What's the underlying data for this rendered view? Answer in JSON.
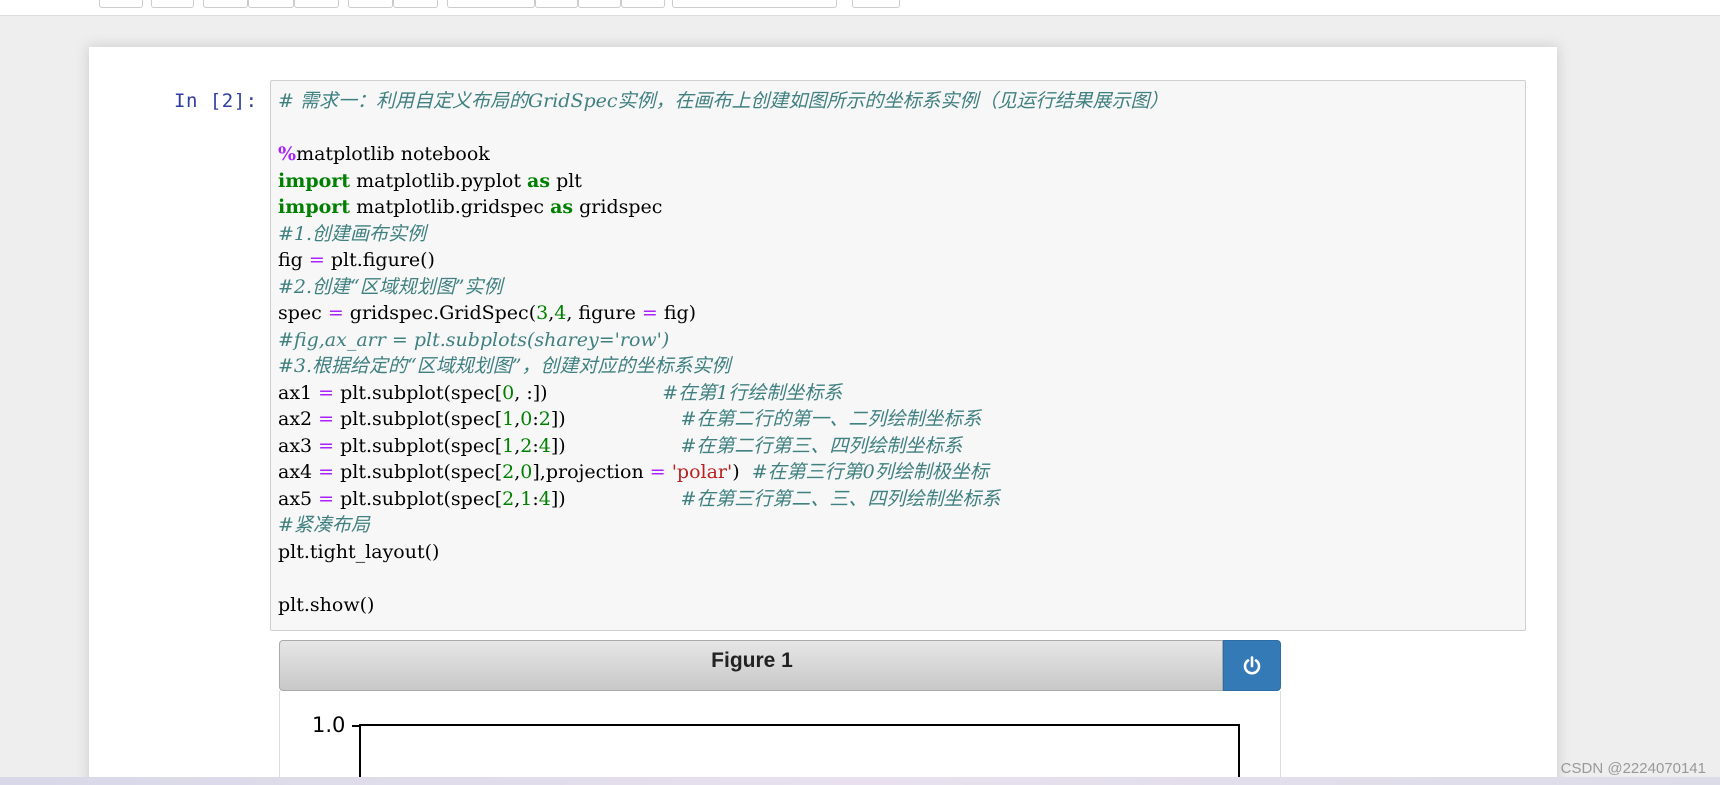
{
  "cell": {
    "prompt": "In  [2]:",
    "lines": [
      [
        {
          "t": "# 需求一：利用自定义布局的GridSpec实例，在画布上创建如图所示的坐标系实例（见运行结果展示图）",
          "c": "com"
        }
      ],
      [],
      [
        {
          "t": "%",
          "c": "magic"
        },
        {
          "t": "matplotlib notebook",
          "c": ""
        }
      ],
      [
        {
          "t": "import",
          "c": "kw"
        },
        {
          "t": " matplotlib.pyplot ",
          "c": ""
        },
        {
          "t": "as",
          "c": "kw"
        },
        {
          "t": " plt",
          "c": ""
        }
      ],
      [
        {
          "t": "import",
          "c": "kw"
        },
        {
          "t": " matplotlib.gridspec ",
          "c": ""
        },
        {
          "t": "as",
          "c": "kw"
        },
        {
          "t": " gridspec",
          "c": ""
        }
      ],
      [
        {
          "t": "#1.创建画布实例",
          "c": "com"
        }
      ],
      [
        {
          "t": "fig ",
          "c": ""
        },
        {
          "t": "=",
          "c": "op"
        },
        {
          "t": " plt.figure()",
          "c": ""
        }
      ],
      [
        {
          "t": "#2.创建“区域规划图”实例",
          "c": "com"
        }
      ],
      [
        {
          "t": "spec ",
          "c": ""
        },
        {
          "t": "=",
          "c": "op"
        },
        {
          "t": " gridspec.GridSpec(",
          "c": ""
        },
        {
          "t": "3",
          "c": "num"
        },
        {
          "t": ",",
          "c": ""
        },
        {
          "t": "4",
          "c": "num"
        },
        {
          "t": ", figure ",
          "c": ""
        },
        {
          "t": "=",
          "c": "op"
        },
        {
          "t": " fig)",
          "c": ""
        }
      ],
      [
        {
          "t": "#fig,ax_arr = plt.subplots(sharey='row')",
          "c": "com"
        }
      ],
      [
        {
          "t": "#3.根据给定的“区域规划图”，创建对应的坐标系实例",
          "c": "com"
        }
      ],
      [
        {
          "t": "ax1 ",
          "c": ""
        },
        {
          "t": "=",
          "c": "op"
        },
        {
          "t": " plt.subplot(spec[",
          "c": ""
        },
        {
          "t": "0",
          "c": "num"
        },
        {
          "t": ", :])                   ",
          "c": ""
        },
        {
          "t": "#在第1行绘制坐标系",
          "c": "com"
        }
      ],
      [
        {
          "t": "ax2 ",
          "c": ""
        },
        {
          "t": "=",
          "c": "op"
        },
        {
          "t": " plt.subplot(spec[",
          "c": ""
        },
        {
          "t": "1",
          "c": "num"
        },
        {
          "t": ",",
          "c": ""
        },
        {
          "t": "0",
          "c": "num"
        },
        {
          "t": ":",
          "c": ""
        },
        {
          "t": "2",
          "c": "num"
        },
        {
          "t": "])                   ",
          "c": ""
        },
        {
          "t": "#在第二行的第一、二列绘制坐标系",
          "c": "com"
        }
      ],
      [
        {
          "t": "ax3 ",
          "c": ""
        },
        {
          "t": "=",
          "c": "op"
        },
        {
          "t": " plt.subplot(spec[",
          "c": ""
        },
        {
          "t": "1",
          "c": "num"
        },
        {
          "t": ",",
          "c": ""
        },
        {
          "t": "2",
          "c": "num"
        },
        {
          "t": ":",
          "c": ""
        },
        {
          "t": "4",
          "c": "num"
        },
        {
          "t": "])                   ",
          "c": ""
        },
        {
          "t": "#在第二行第三、四列绘制坐标系",
          "c": "com"
        }
      ],
      [
        {
          "t": "ax4 ",
          "c": ""
        },
        {
          "t": "=",
          "c": "op"
        },
        {
          "t": " plt.subplot(spec[",
          "c": ""
        },
        {
          "t": "2",
          "c": "num"
        },
        {
          "t": ",",
          "c": ""
        },
        {
          "t": "0",
          "c": "num"
        },
        {
          "t": "],projection ",
          "c": ""
        },
        {
          "t": "=",
          "c": "op"
        },
        {
          "t": " ",
          "c": ""
        },
        {
          "t": "'polar'",
          "c": "str"
        },
        {
          "t": ")  ",
          "c": ""
        },
        {
          "t": "#在第三行第0列绘制极坐标",
          "c": "com"
        }
      ],
      [
        {
          "t": "ax5 ",
          "c": ""
        },
        {
          "t": "=",
          "c": "op"
        },
        {
          "t": " plt.subplot(spec[",
          "c": ""
        },
        {
          "t": "2",
          "c": "num"
        },
        {
          "t": ",",
          "c": ""
        },
        {
          "t": "1",
          "c": "num"
        },
        {
          "t": ":",
          "c": ""
        },
        {
          "t": "4",
          "c": "num"
        },
        {
          "t": "])                   ",
          "c": ""
        },
        {
          "t": "#在第三行第二、三、四列绘制坐标系",
          "c": "com"
        }
      ],
      [
        {
          "t": "#紧凑布局",
          "c": "com"
        }
      ],
      [
        {
          "t": "plt.tight_layout()",
          "c": ""
        }
      ],
      [],
      [
        {
          "t": "plt.show()",
          "c": ""
        }
      ]
    ]
  },
  "figure": {
    "title": "Figure 1",
    "close_icon": "power-icon",
    "accent_color": "#337ab7",
    "ytick_label": "1.0"
  },
  "watermark": "CSDN @2224070141"
}
